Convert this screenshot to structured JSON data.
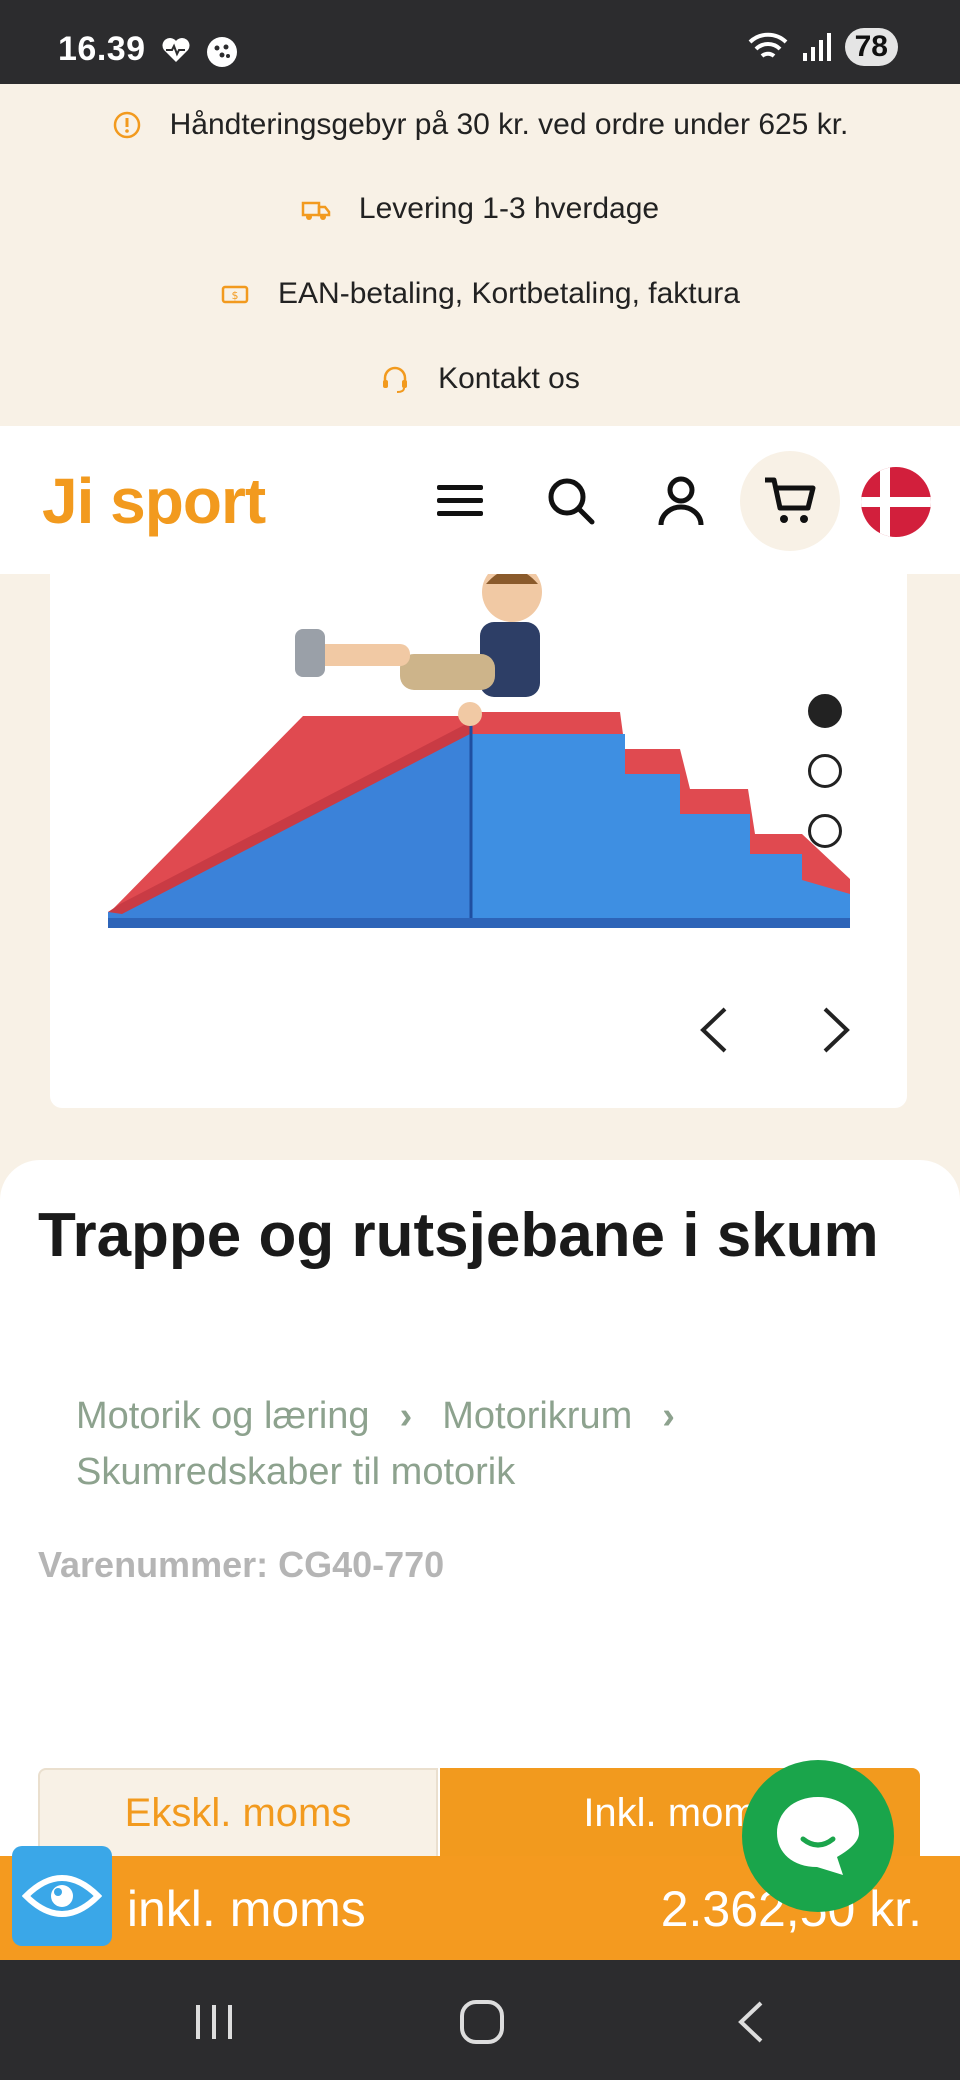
{
  "status": {
    "time": "16.39",
    "battery": "78"
  },
  "info": {
    "fee": "Håndteringsgebyr på 30 kr. ved ordre under 625 kr.",
    "delivery": "Levering 1-3 hverdage",
    "payment": "EAN-betaling, Kortbetaling, faktura",
    "contact": "Kontakt os"
  },
  "header": {
    "logo": "Ji sport"
  },
  "product": {
    "title": "Trappe og rutsjebane i skum",
    "breadcrumbs": [
      "Motorik og læring",
      "Motorikrum",
      "Skumredskaber til motorik"
    ],
    "sku": "Varenummer: CG40-770"
  },
  "tabs": {
    "excl": "Ekskl. moms",
    "incl": "Inkl. moms"
  },
  "price": {
    "label": "s inkl. moms",
    "amount": "2.362,50 kr."
  },
  "colors": {
    "accent": "#f29a1e",
    "cream": "#f8f1e6",
    "chat": "#1aa54b",
    "breadcrumb": "#8da28e"
  }
}
